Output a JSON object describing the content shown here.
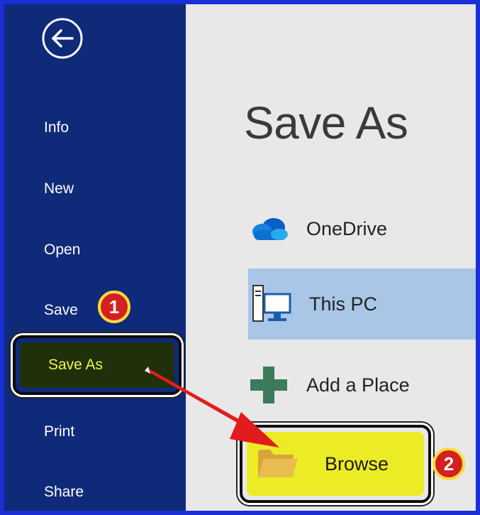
{
  "sidebar": {
    "back_icon": "back-arrow-icon",
    "items": [
      {
        "label": "Info"
      },
      {
        "label": "New"
      },
      {
        "label": "Open"
      },
      {
        "label": "Save"
      },
      {
        "label": "Save As"
      },
      {
        "label": "Print"
      },
      {
        "label": "Share"
      }
    ]
  },
  "main": {
    "title": "Save As",
    "locations": [
      {
        "label": "OneDrive",
        "icon": "onedrive-cloud-icon"
      },
      {
        "label": "This PC",
        "icon": "computer-icon"
      },
      {
        "label": "Add a Place",
        "icon": "plus-icon"
      },
      {
        "label": "Browse",
        "icon": "folder-icon"
      }
    ]
  },
  "annotations": {
    "step1": "1",
    "step2": "2"
  },
  "colors": {
    "sidebar_bg": "#0f2a78",
    "main_bg": "#e8e8e8",
    "selected_location_bg": "#a9c6e6",
    "browse_highlight": "#ecec26",
    "badge_fill": "#d42020",
    "badge_ring": "#ffdc3b",
    "arrow": "#e21c1c",
    "frame_border": "#1a2fd6"
  }
}
